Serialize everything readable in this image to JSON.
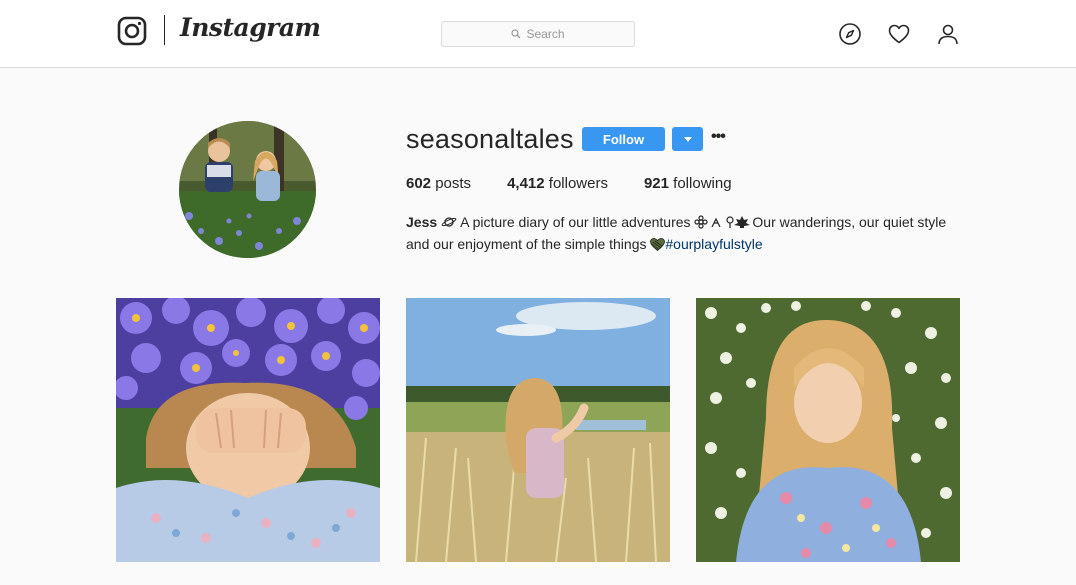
{
  "header": {
    "brand": "Instagram",
    "search": {
      "placeholder": "Search"
    },
    "nav": [
      "compass-icon",
      "heart-icon",
      "profile-icon"
    ]
  },
  "profile": {
    "username": "seasonaltales",
    "follow_label": "Follow",
    "more_label": "•••",
    "stats": {
      "posts_count": "602",
      "posts_label": "posts",
      "followers_count": "4,412",
      "followers_label": "followers",
      "following_count": "921",
      "following_label": "following"
    },
    "bio": {
      "name": "Jess",
      "line1": "A picture diary of our little adventures",
      "line1_tail": "Our wanderings, our quiet style",
      "line2": "and our enjoyment of the simple things",
      "hashtag": "#ourplayfulstyle"
    }
  },
  "posts": [
    {
      "id": "post-1",
      "subject": "child-lying-in-purple-flowers"
    },
    {
      "id": "post-2",
      "subject": "child-in-grass-field"
    },
    {
      "id": "post-3",
      "subject": "child-in-white-blossoms"
    }
  ],
  "colors": {
    "accent": "#3897f0",
    "link": "#003569",
    "background": "#fafafa",
    "text": "#262626"
  }
}
